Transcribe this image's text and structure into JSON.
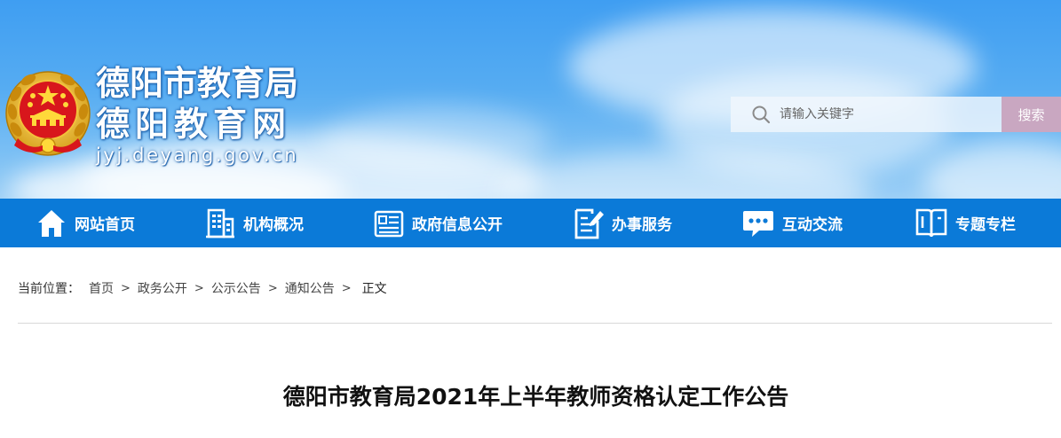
{
  "header": {
    "title_line1": "德阳市教育局",
    "title_line2": "德阳教育网",
    "domain": "jyj.deyang.gov.cn",
    "emblem_icon": "national-emblem-icon",
    "colors": {
      "banner_sky": "#4ea6f2",
      "title_text": "#ffffff",
      "title_outline": "#1f63ad"
    }
  },
  "search": {
    "placeholder": "请输入关键字",
    "button_label": "搜索",
    "icon": "search-icon",
    "colors": {
      "button_bg": "#c9a7c1"
    }
  },
  "nav": {
    "background": "#0b7ad8",
    "items": [
      {
        "label": "网站首页",
        "icon": "home-icon"
      },
      {
        "label": "机构概况",
        "icon": "building-icon"
      },
      {
        "label": "政府信息公开",
        "icon": "document-list-icon"
      },
      {
        "label": "办事服务",
        "icon": "edit-document-icon"
      },
      {
        "label": "互动交流",
        "icon": "chat-bubble-icon"
      },
      {
        "label": "专题专栏",
        "icon": "book-icon"
      }
    ]
  },
  "breadcrumb": {
    "prefix": "当前位置：",
    "items": [
      "首页",
      "政务公开",
      "公示公告",
      "通知公告"
    ],
    "separator": ">",
    "current": "正文"
  },
  "article": {
    "title": "德阳市教育局2021年上半年教师资格认定工作公告"
  }
}
